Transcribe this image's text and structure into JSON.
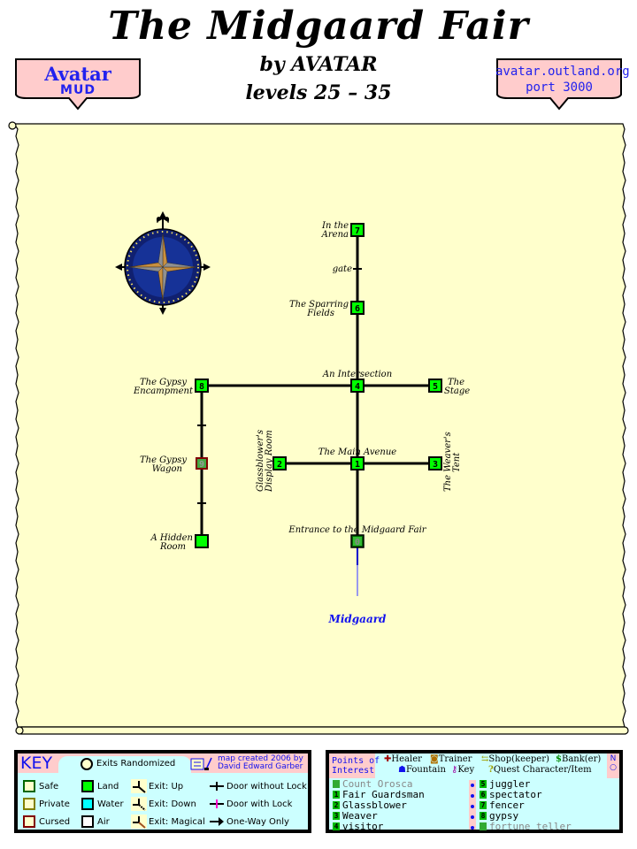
{
  "header": {
    "title": "The Midgaard Fair",
    "author": "by AVATAR",
    "levels": "levels 25 – 35"
  },
  "badges": {
    "left": {
      "line1": "Avatar",
      "line2": "MUD"
    },
    "right": {
      "line1": "avatar.outland.org",
      "line2": "port 3000"
    }
  },
  "colors": {
    "parchment": "#ffffcc",
    "land": "#00ff00",
    "water": "#00ffff",
    "key_bg": "#ccffff",
    "key_header": "#ffcccc",
    "accent_blue": "#1111ee",
    "cursed_border": "#800000",
    "private_border": "#808000",
    "safe_border": "#006600"
  },
  "map": {
    "rooms": [
      {
        "id": "entrance",
        "number": "0",
        "label": [
          "Entrance to the Midgaard Fair"
        ],
        "sector": "land",
        "flag": "safe"
      },
      {
        "id": "main-avenue",
        "number": "1",
        "label": [
          "The Main Avenue"
        ],
        "sector": "land"
      },
      {
        "id": "glassblower-display",
        "number": "2",
        "label": [
          "Glassblower's",
          "Display Room"
        ],
        "sector": "land"
      },
      {
        "id": "weavers-tent",
        "number": "3",
        "label": [
          "The Weaver's",
          "Tent"
        ],
        "sector": "land"
      },
      {
        "id": "intersection",
        "number": "4",
        "label": [
          "An Intersection"
        ],
        "sector": "land"
      },
      {
        "id": "stage",
        "number": "5",
        "label": [
          "The",
          "Stage"
        ],
        "sector": "land"
      },
      {
        "id": "sparring-fields",
        "number": "6",
        "label": [
          "The Sparring",
          "Fields"
        ],
        "sector": "land"
      },
      {
        "id": "arena",
        "number": "7",
        "label": [
          "In the",
          "Arena"
        ],
        "sector": "land"
      },
      {
        "id": "gypsy-encampment",
        "number": "8",
        "label": [
          "The Gypsy",
          "Encampment"
        ],
        "sector": "land"
      },
      {
        "id": "gypsy-wagon",
        "number": "9",
        "label": [
          "The Gypsy",
          "Wagon"
        ],
        "sector": "land",
        "flag": "cursed"
      },
      {
        "id": "hidden-room",
        "number": "",
        "label": [
          "A Hidden",
          "Room"
        ],
        "sector": "land"
      }
    ],
    "gate_label": "gate",
    "exit_label": "Midgaard"
  },
  "key": {
    "title": "KEY",
    "exits_randomized": "Exits Randomized",
    "credit_line1": "map created 2006 by",
    "credit_line2": "David Edward Garber",
    "flags": [
      "Safe",
      "Private",
      "Cursed"
    ],
    "sectors": [
      "Land",
      "Water",
      "Air"
    ],
    "exits": [
      "Exit: Up",
      "Exit: Down",
      "Exit: Magical"
    ],
    "doors": [
      "Door without Lock",
      "Door with Lock",
      "One-Way Only"
    ]
  },
  "poi": {
    "title_line1": "Points of",
    "title_line2": "Interest",
    "legend_row1": [
      {
        "icon": "healer-icon",
        "glyph": "✚",
        "label": "Healer"
      },
      {
        "icon": "trainer-icon",
        "glyph": "◙",
        "label": "Trainer"
      },
      {
        "icon": "shop-icon",
        "glyph": "⇆",
        "label": "Shop(keeper)"
      },
      {
        "icon": "bank-icon",
        "glyph": "$",
        "label": "Bank(er)"
      }
    ],
    "legend_row2": [
      {
        "icon": "fountain-icon",
        "glyph": "☗",
        "label": "Fountain"
      },
      {
        "icon": "key-icon",
        "glyph": "⚷",
        "label": "Key"
      },
      {
        "icon": "quest-icon",
        "glyph": "?",
        "label": "Quest Character/Item"
      }
    ],
    "compass": "N",
    "items_left": [
      {
        "number": "0",
        "name": "Count Orosca",
        "dim": true
      },
      {
        "number": "1",
        "name": "Fair Guardsman",
        "dim": false
      },
      {
        "number": "2",
        "name": "Glassblower",
        "dim": false
      },
      {
        "number": "3",
        "name": "Weaver",
        "dim": false
      },
      {
        "number": "4",
        "name": "visitor",
        "dim": false
      }
    ],
    "items_right": [
      {
        "number": "5",
        "name": "juggler",
        "dim": false
      },
      {
        "number": "6",
        "name": "spectator",
        "dim": false
      },
      {
        "number": "7",
        "name": "fencer",
        "dim": false
      },
      {
        "number": "8",
        "name": "gypsy",
        "dim": false
      },
      {
        "number": "9",
        "name": "fortune teller",
        "dim": true
      }
    ]
  }
}
